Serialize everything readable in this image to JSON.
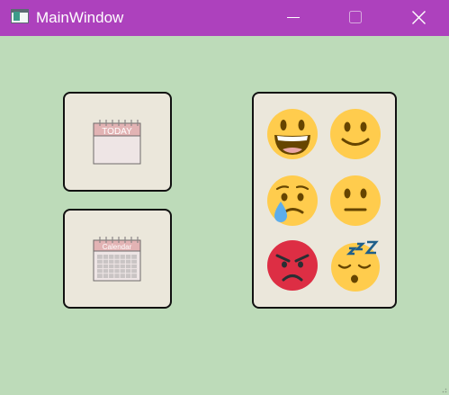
{
  "window": {
    "title": "MainWindow",
    "controls": [
      "minimize-icon",
      "maximize-icon",
      "close-icon"
    ]
  },
  "calendars": {
    "today": {
      "header_label": "TODAY",
      "icon": "calendar-today-icon"
    },
    "month": {
      "header_label": "Calendar",
      "icon": "calendar-month-icon"
    }
  },
  "emojis": [
    {
      "name": "grinning-face-emoji"
    },
    {
      "name": "slightly-smiling-face-emoji"
    },
    {
      "name": "crying-face-emoji"
    },
    {
      "name": "neutral-face-emoji"
    },
    {
      "name": "angry-face-emoji"
    },
    {
      "name": "sleeping-face-emoji"
    }
  ],
  "colors": {
    "titlebar": "#ad41bd",
    "background": "#bddbb9",
    "card": "#ebe7db",
    "emoji_yellow": "#ffcc4d",
    "emoji_red": "#dd2e44"
  }
}
